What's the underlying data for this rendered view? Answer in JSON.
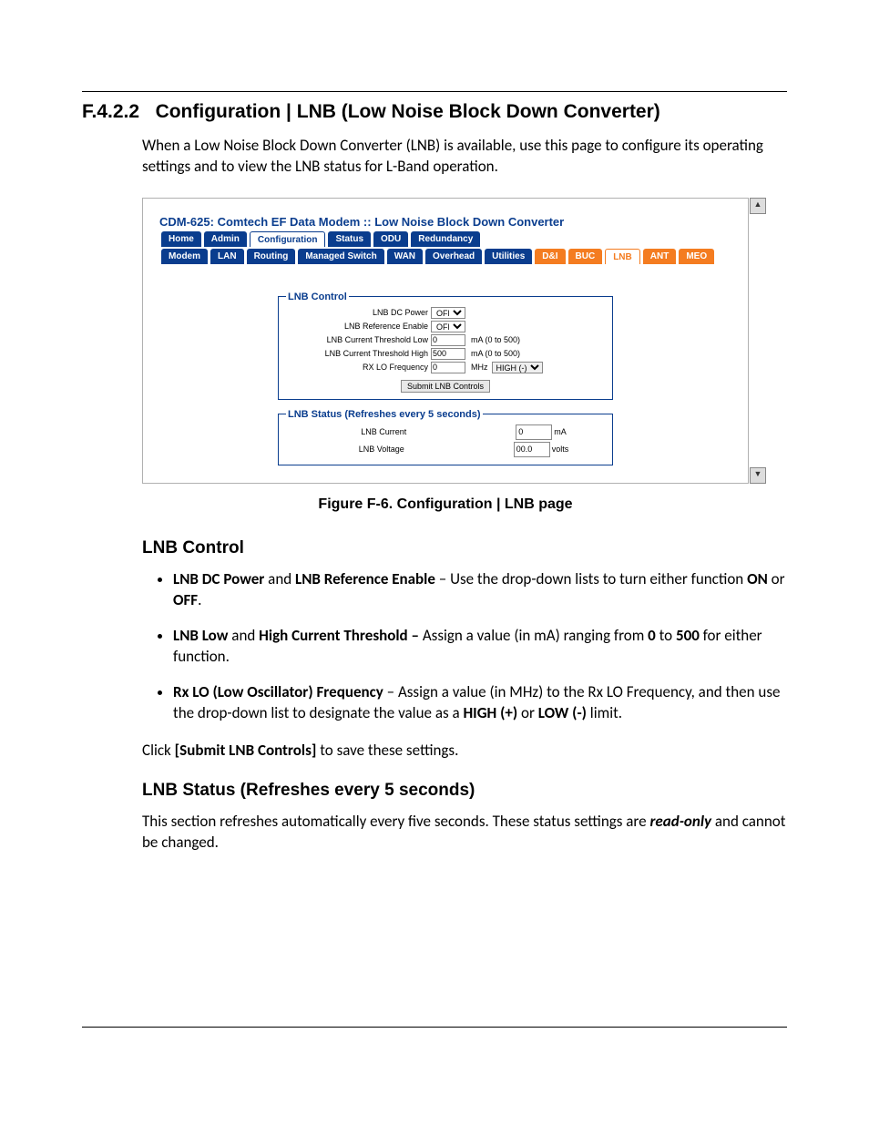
{
  "section": {
    "number": "F.4.2.2",
    "title": "Configuration | LNB (Low Noise Block Down Converter)"
  },
  "intro": "When a Low Noise Block Down Converter (LNB) is available, use this page to configure its operating settings and to view the LNB status for L-Band operation.",
  "app": {
    "title": "CDM-625: Comtech EF Data Modem :: Low Noise Block Down Converter",
    "tabs_row1": [
      "Home",
      "Admin",
      "Configuration",
      "Status",
      "ODU",
      "Redundancy"
    ],
    "tabs_row1_active": "Configuration",
    "tabs_row2": [
      "Modem",
      "LAN",
      "Routing",
      "Managed Switch",
      "WAN",
      "Overhead",
      "Utilities",
      "D&I",
      "BUC",
      "LNB",
      "ANT",
      "MEO"
    ],
    "tabs_row2_active": "LNB",
    "lnb_control": {
      "legend": "LNB Control",
      "dc_power": {
        "label": "LNB DC Power",
        "value": "OFF"
      },
      "ref_enable": {
        "label": "LNB Reference Enable",
        "value": "OFF"
      },
      "thresh_low": {
        "label": "LNB Current Threshold Low",
        "value": "0",
        "suffix": "mA (0 to 500)"
      },
      "thresh_high": {
        "label": "LNB Current Threshold High",
        "value": "500",
        "suffix": "mA (0 to 500)"
      },
      "rx_lo": {
        "label": "RX LO Frequency",
        "value": "0",
        "suffix": "MHz",
        "mode": "HIGH (-)"
      },
      "submit": "Submit LNB Controls"
    },
    "lnb_status": {
      "legend": "LNB Status (Refreshes every 5 seconds)",
      "current": {
        "label": "LNB Current",
        "value": "0",
        "unit": "mA"
      },
      "voltage": {
        "label": "LNB Voltage",
        "value": "00.0",
        "unit": "volts"
      }
    }
  },
  "figure_caption": "Figure F-6. Configuration | LNB page",
  "subhead1": "LNB Control",
  "bullets": [
    {
      "b1": "LNB DC Power",
      "mid": " and ",
      "b2": "LNB Reference Enable",
      "rest": " – Use the drop-down lists to turn either function ",
      "b3": "ON",
      "mid2": " or ",
      "b4": "OFF",
      "tail": "."
    },
    {
      "b1": "LNB Low",
      "mid": " and ",
      "b2": "High Current Threshold – ",
      "rest": "Assign a value (in mA) ranging from ",
      "b3": "0",
      "mid2": " to ",
      "b4": "500",
      "tail": " for either function."
    },
    {
      "b1": "Rx LO (Low Oscillator) Frequency",
      "rest": " – Assign a value (in MHz) to the Rx LO Frequency, and then use the drop-down list to designate the value as a ",
      "b3": "HIGH (+)",
      "mid2": " or ",
      "b4": "LOW (-)",
      "tail": " limit."
    }
  ],
  "click_para": {
    "pre": "Click ",
    "btn": "[Submit LNB Controls]",
    "post": " to save these settings."
  },
  "subhead2": "LNB Status (Refreshes every 5 seconds)",
  "status_para": {
    "pre": "This section refreshes automatically every five seconds. These status settings are ",
    "em": "read-only",
    "post": " and cannot be changed."
  }
}
